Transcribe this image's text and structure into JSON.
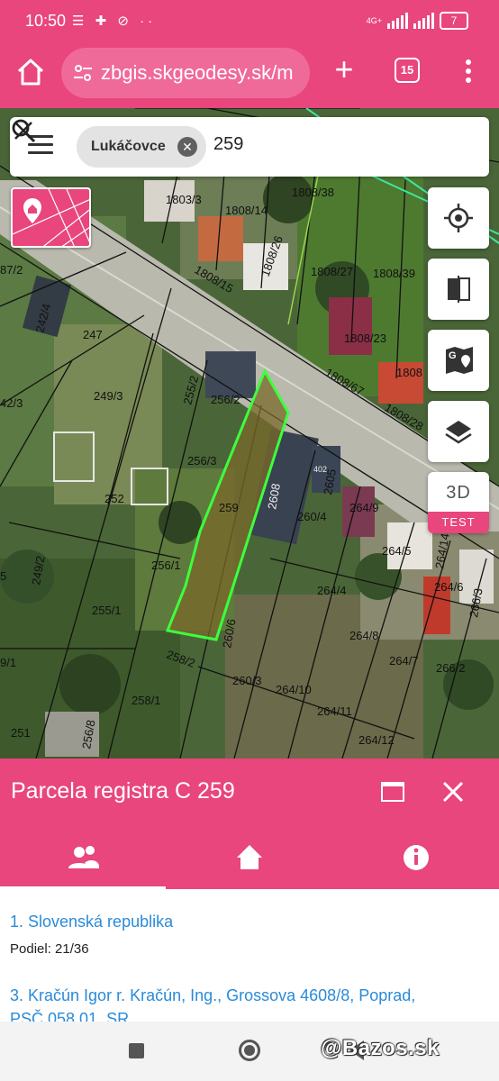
{
  "status_bar": {
    "time": "10:50",
    "left_icons": "☰ ✚ ⊘ ··",
    "network": "4G+",
    "battery": "7"
  },
  "browser": {
    "url": "zbgis.skgeodesy.sk/m",
    "tab_count": "15"
  },
  "search": {
    "chip_label": "Lukáčovce",
    "query": "259"
  },
  "map": {
    "parcel_labels": [
      "1803/3",
      "1808/14",
      "1808/38",
      "1808/26",
      "1808/27",
      "1808/39",
      "1808/15",
      "1808/23",
      "1808",
      "1808/67",
      "1808/28",
      "242/4",
      "247",
      "249/3",
      "255/2",
      "256/2",
      "256/3",
      "259",
      "2608",
      "402",
      "2605",
      "260/4",
      "264/9",
      "252",
      "264/5",
      "264/14",
      "249/2",
      "256/1",
      "255/1",
      "264/4",
      "264/6",
      "266/3",
      "264/8",
      "264/7",
      "258/2",
      "260/6",
      "260/3",
      "264/10",
      "258/1",
      "264/11",
      "264/12",
      "266/2",
      "251",
      "256/8",
      "87/2",
      "42/3",
      "5",
      "9/1",
      "260/3"
    ],
    "highlight_color": "#3dff3d",
    "accent_color": "#e8467c"
  },
  "map_controls": {
    "btn_3d": "3D",
    "test_badge": "TEST"
  },
  "panel": {
    "title": "Parcela registra C 259",
    "owners": [
      {
        "name": "1. Slovenská republika",
        "share": "Podiel: 21/36"
      },
      {
        "name": "3. Kračún Igor r. Kračún, Ing., Grossova 4608/8, Poprad,",
        "name_line2": "PSČ 058 01, SR"
      }
    ]
  },
  "navbar": {
    "watermark": "@Bazos.sk"
  }
}
